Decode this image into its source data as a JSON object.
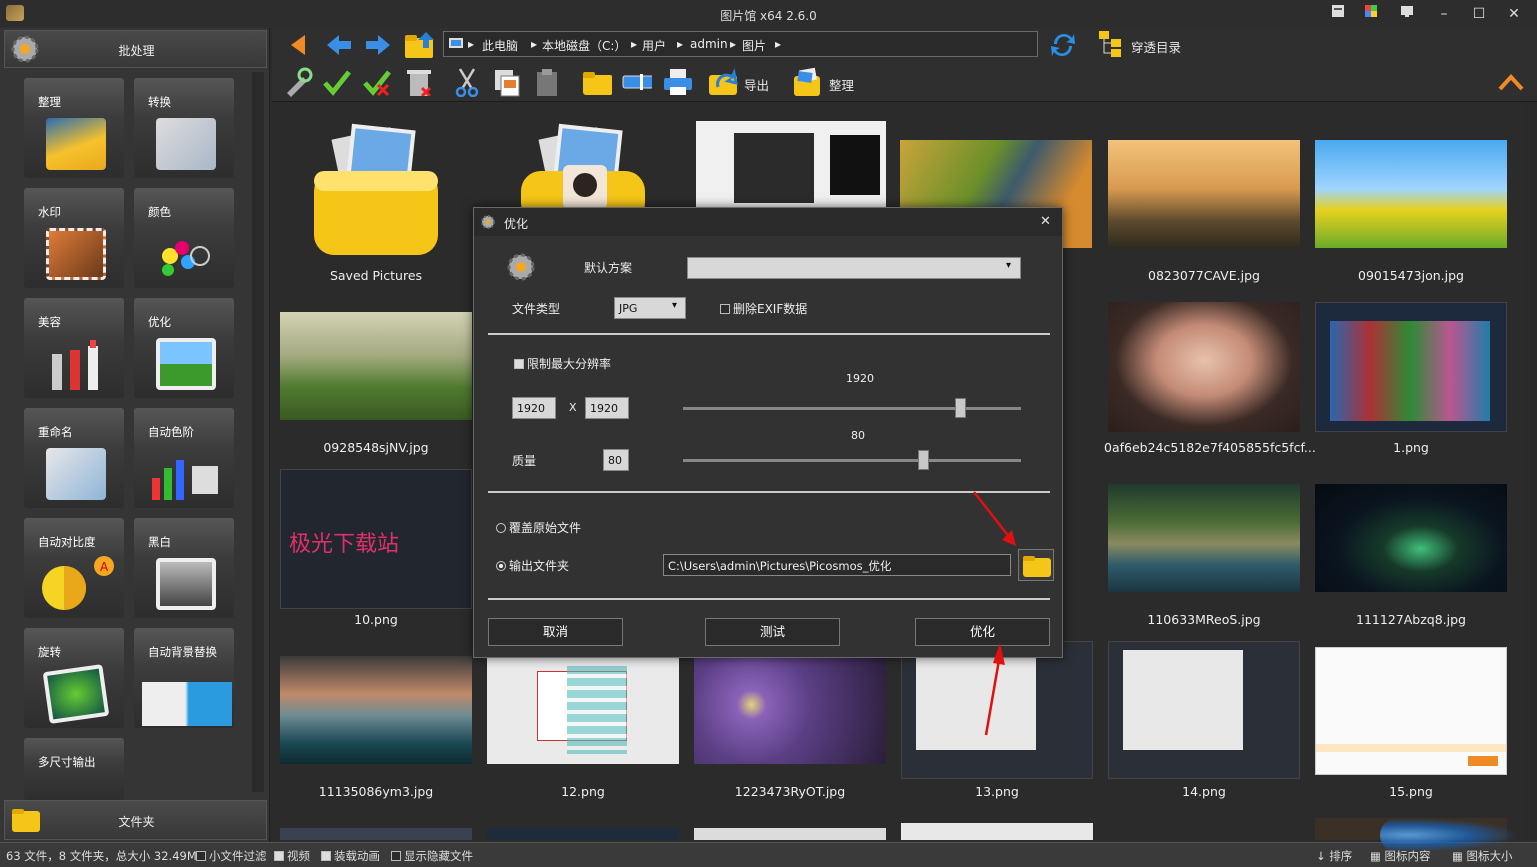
{
  "window": {
    "title": "图片馆 x64 2.6.0"
  },
  "left_panel": {
    "batch_label": "批处理",
    "tools": [
      {
        "label": "整理"
      },
      {
        "label": "转换"
      },
      {
        "label": "水印"
      },
      {
        "label": "颜色"
      },
      {
        "label": "美容"
      },
      {
        "label": "优化"
      },
      {
        "label": "重命名"
      },
      {
        "label": "自动色阶"
      },
      {
        "label": "自动对比度"
      },
      {
        "label": "黑白"
      },
      {
        "label": "旋转"
      },
      {
        "label": "自动背景替换"
      },
      {
        "label": "多尺寸输出"
      }
    ],
    "folder_label": "文件夹"
  },
  "toolbar": {
    "breadcrumbs": [
      "此电脑",
      "本地磁盘（C:）",
      "用户",
      "admin",
      "图片"
    ],
    "through_dir": "穿透目录",
    "export": "导出",
    "organize": "整理"
  },
  "grid": {
    "items": [
      {
        "name": "Saved Pictures",
        "kind": "folder"
      },
      {
        "name": "",
        "kind": "folder-avatar"
      },
      {
        "name": "",
        "kind": "screenshot"
      },
      {
        "name": "",
        "kind": "photo"
      },
      {
        "name": "0823077CAVE.jpg",
        "kind": "photo"
      },
      {
        "name": "09015473jon.jpg",
        "kind": "photo"
      },
      {
        "name": "0928548sjNV.jpg",
        "kind": "photo"
      },
      {
        "name": "0af6eb24c5182e7f405855fc5fcf...",
        "kind": "photo"
      },
      {
        "name": "1.png",
        "kind": "screenshot"
      },
      {
        "name": "10.png",
        "kind": "screenshot",
        "watermark": "极光下载站"
      },
      {
        "name": "110633MReoS.jpg",
        "kind": "photo"
      },
      {
        "name": "111127Abzq8.jpg",
        "kind": "photo"
      },
      {
        "name": "11135086ym3.jpg",
        "kind": "photo"
      },
      {
        "name": "12.png",
        "kind": "screenshot"
      },
      {
        "name": "1223473RyOT.jpg",
        "kind": "photo"
      },
      {
        "name": "13.png",
        "kind": "screenshot"
      },
      {
        "name": "14.png",
        "kind": "screenshot"
      },
      {
        "name": "15.png",
        "kind": "screenshot"
      }
    ]
  },
  "statusbar": {
    "summary": "63 文件，8 文件夹，总大小 32.49M",
    "small_filter": "小文件过滤",
    "video": "视频",
    "load_anim": "装载动画",
    "show_hidden": "显示隐藏文件",
    "sort": "排序",
    "icon_content": "图标内容",
    "icon_size": "图标大小"
  },
  "dialog": {
    "title": "优化",
    "default_scheme_label": "默认方案",
    "default_scheme_value": "",
    "file_type_label": "文件类型",
    "file_type_value": "JPG",
    "remove_exif": "删除EXIF数据",
    "limit_res": "限制最大分辨率",
    "width": "1920",
    "x": "X",
    "height": "1920",
    "res_slider_value": "1920",
    "res_slider_fraction": 0.82,
    "quality_label": "质量",
    "quality_value": "80",
    "quality_slider_fraction": 0.71,
    "overwrite": "覆盖原始文件",
    "output_folder": "输出文件夹",
    "output_path": "C:\\Users\\admin\\Pictures\\Picosmos_优化",
    "cancel": "取消",
    "test": "测试",
    "optimize": "优化"
  },
  "colors": {
    "accent_orange": "#f08a24",
    "blue": "#3a8ee6",
    "folder_yellow": "#f5c518"
  }
}
